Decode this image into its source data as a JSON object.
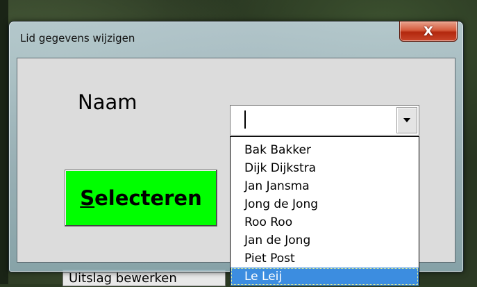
{
  "window": {
    "title": "Lid gegevens wijzigen",
    "close_label": "X"
  },
  "form": {
    "name_label": "Naam",
    "combo_value": "",
    "select_button_hotkey": "S",
    "select_button_rest": "electeren",
    "select_button_color": "#00ff00"
  },
  "dropdown": {
    "items": [
      "Bak Bakker",
      "Dijk Dijkstra",
      "Jan Jansma",
      "Jong de Jong",
      "Roo Roo",
      "Jan de Jong",
      "Piet Post",
      "Le Leij"
    ],
    "selected_index": 7,
    "highlight_color": "#3c8de0"
  },
  "background": {
    "partial_button_label": "Uitslag bewerken"
  }
}
